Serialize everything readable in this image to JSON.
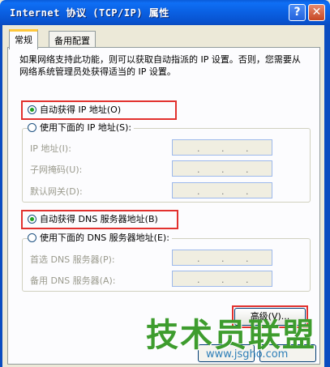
{
  "window": {
    "title": "Internet 协议 (TCP/IP) 属性",
    "help_glyph": "?",
    "close_glyph": "✕"
  },
  "tabs": [
    {
      "label": "常规",
      "active": true
    },
    {
      "label": "备用配置",
      "active": false
    }
  ],
  "description": "如果网络支持此功能，则可以获取自动指派的 IP 设置。否则，您需要从网络系统管理员处获得适当的 IP 设置。",
  "ip_section": {
    "auto_label": "自动获得 IP 地址(O)",
    "auto_selected": true,
    "manual_label": "使用下面的 IP 地址(S):",
    "fields": [
      {
        "label": "IP 地址(I):"
      },
      {
        "label": "子网掩码(U):"
      },
      {
        "label": "默认网关(D):"
      }
    ]
  },
  "dns_section": {
    "auto_label": "自动获得 DNS 服务器地址(B)",
    "auto_selected": true,
    "manual_label": "使用下面的 DNS 服务器地址(E):",
    "fields": [
      {
        "label": "首选 DNS 服务器(P):"
      },
      {
        "label": "备用 DNS 服务器(A):"
      }
    ]
  },
  "ip_dot": ".",
  "advanced_button": "高级(V)...",
  "watermark": {
    "text": "技术员联盟",
    "url": "www.jsgho.com"
  },
  "colors": {
    "highlight": "#E2312E",
    "titlebar": "#0A61E4",
    "radio_dot": "#21A121"
  }
}
